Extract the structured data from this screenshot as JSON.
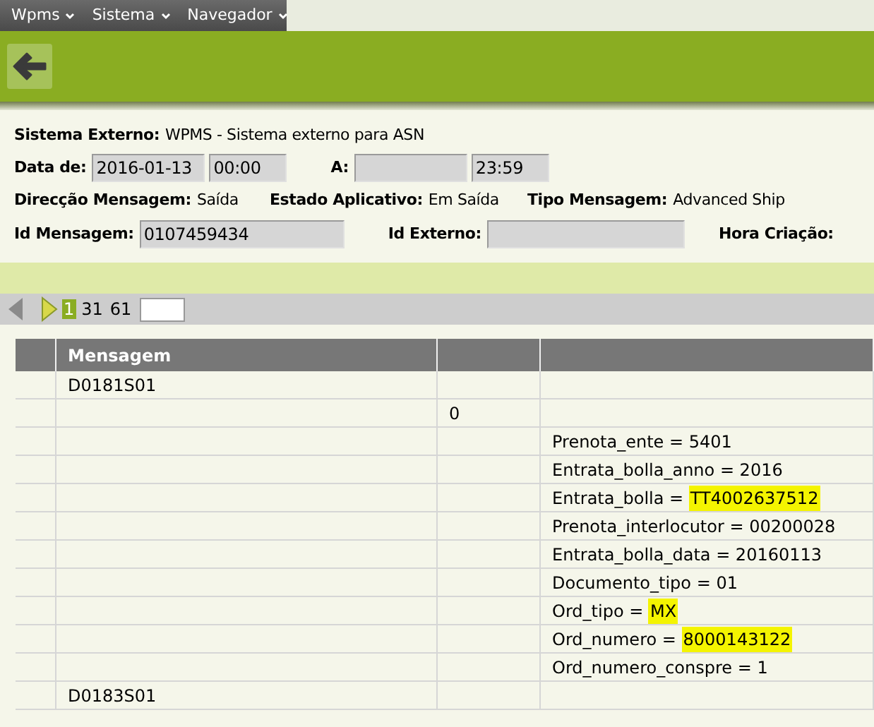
{
  "menu": [
    {
      "label": "Wpms"
    },
    {
      "label": "Sistema"
    },
    {
      "label": "Navegador"
    }
  ],
  "form": {
    "sistema_externo": {
      "label": "Sistema Externo:",
      "value": "WPMS - Sistema externo para ASN"
    },
    "data_de": {
      "label": "Data de:",
      "date": "2016-01-13",
      "time": "00:00"
    },
    "a": {
      "label": "A:",
      "time": "23:59"
    },
    "direccao": {
      "label": "Direcção Mensagem:",
      "value": "Saída"
    },
    "estado": {
      "label": "Estado Aplicativo:",
      "value": "Em Saída"
    },
    "tipo": {
      "label": "Tipo Mensagem:",
      "value": "Advanced Ship"
    },
    "id_mensagem": {
      "label": "Id Mensagem:",
      "value": "0107459434"
    },
    "id_externo": {
      "label": "Id Externo:"
    },
    "hora": {
      "label": "Hora Criação:"
    }
  },
  "pager": {
    "pages": [
      {
        "label": "1",
        "selected": true
      },
      {
        "label": "31",
        "selected": false
      },
      {
        "label": "61",
        "selected": false
      }
    ]
  },
  "table": {
    "columns": [
      "",
      "Mensagem",
      "",
      ""
    ],
    "rows": [
      {
        "cells": [
          "",
          "D0181S01",
          "",
          ""
        ]
      },
      {
        "cells": [
          "",
          "",
          "0",
          ""
        ]
      },
      {
        "cells": [
          "",
          "",
          "",
          ""
        ],
        "label": "Prenota_ente = 5401"
      },
      {
        "cells": [
          "",
          "",
          "",
          ""
        ],
        "label": "Entrata_bolla_anno = 2016"
      },
      {
        "cells": [
          "",
          "",
          "",
          ""
        ],
        "label": "Entrata_bolla = ",
        "value": "TT4002637512",
        "highlighted": true
      },
      {
        "cells": [
          "",
          "",
          "",
          ""
        ],
        "label": "Prenota_interlocutor = 00200028"
      },
      {
        "cells": [
          "",
          "",
          "",
          ""
        ],
        "label": "Entrata_bolla_data = 20160113"
      },
      {
        "cells": [
          "",
          "",
          "",
          ""
        ],
        "label": "Documento_tipo = 01"
      },
      {
        "cells": [
          "",
          "",
          "",
          ""
        ],
        "label": "Ord_tipo = ",
        "value": "MX",
        "highlighted": true
      },
      {
        "cells": [
          "",
          "",
          "",
          ""
        ],
        "label": "Ord_numero = ",
        "value": "8000143122",
        "highlighted": true
      },
      {
        "cells": [
          "",
          "",
          "",
          ""
        ],
        "label": "Ord_numero_conspre = 1"
      },
      {
        "cells": [
          "",
          "D0183S01",
          "",
          ""
        ]
      }
    ]
  }
}
